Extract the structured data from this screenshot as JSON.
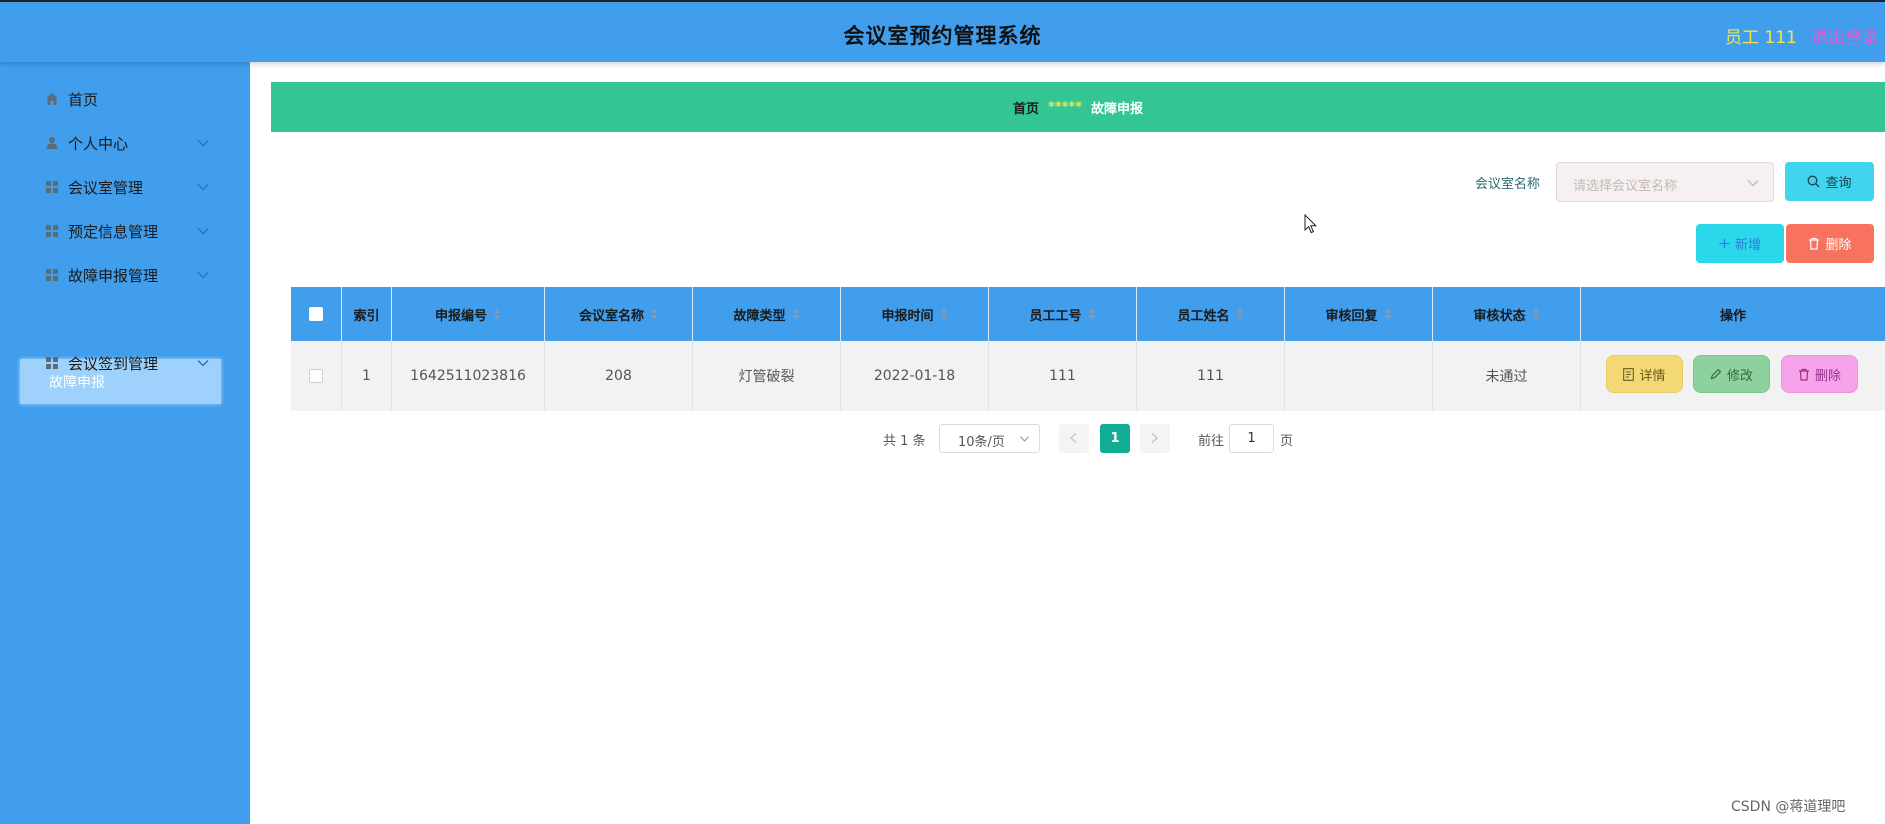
{
  "header": {
    "title": "会议室预约管理系统",
    "user": "员工 111",
    "logout": "退出登录"
  },
  "sidebar": {
    "items": [
      {
        "label": "首页",
        "icon": "home-icon"
      },
      {
        "label": "个人中心",
        "icon": "user-icon"
      },
      {
        "label": "会议室管理",
        "icon": "grid-icon"
      },
      {
        "label": "预定信息管理",
        "icon": "grid-icon"
      },
      {
        "label": "故障申报管理",
        "icon": "grid-icon"
      },
      {
        "label": "会议签到管理",
        "icon": "grid-icon"
      }
    ],
    "active_sub": "故障申报"
  },
  "breadcrumb": {
    "home": "首页",
    "separator": "*****",
    "current": "故障申报"
  },
  "filter": {
    "label": "会议室名称",
    "placeholder": "请选择会议室名称"
  },
  "buttons": {
    "query": "查询",
    "add": "新增",
    "delete": "删除"
  },
  "table": {
    "headers": {
      "index": "索引",
      "report_no": "申报编号",
      "room_name": "会议室名称",
      "fault_type": "故障类型",
      "report_time": "申报时间",
      "emp_no": "员工工号",
      "emp_name": "员工姓名",
      "review_reply": "审核回复",
      "review_status": "审核状态",
      "actions": "操作"
    },
    "rows": [
      {
        "index": "1",
        "report_no": "1642511023816",
        "room_name": "208",
        "fault_type": "灯管破裂",
        "report_time": "2022-01-18",
        "emp_no": "111",
        "emp_name": "111",
        "review_reply": "",
        "review_status": "未通过"
      }
    ],
    "row_actions": {
      "detail": "详情",
      "edit": "修改",
      "delete": "删除"
    }
  },
  "pagination": {
    "total": "共 1 条",
    "page_size": "10条/页",
    "current": "1",
    "goto": "前往",
    "goto_value": "1",
    "page_unit": "页"
  },
  "watermark": "CSDN @蒋道理吧",
  "colors": {
    "header": "#409eed",
    "breadcrumb_bar": "#33c694",
    "active_page": "#13ad96"
  }
}
